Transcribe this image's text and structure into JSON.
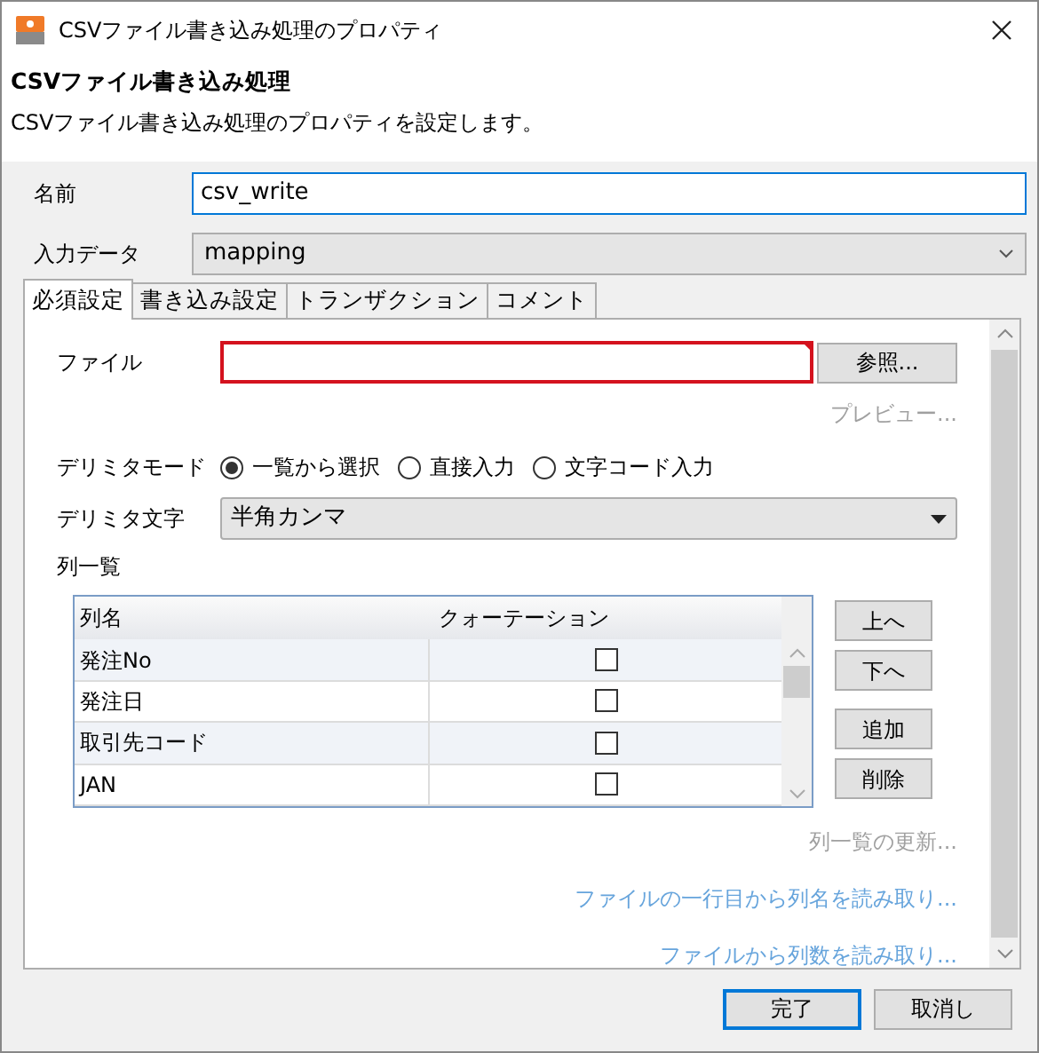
{
  "window": {
    "title": "CSVファイル書き込み処理のプロパティ"
  },
  "header": {
    "title": "CSVファイル書き込み処理",
    "description": "CSVファイル書き込み処理のプロパティを設定します。"
  },
  "name_field": {
    "label": "名前",
    "value": "csv_write"
  },
  "input_data": {
    "label": "入力データ",
    "value": "mapping"
  },
  "tabs": [
    {
      "label": "必須設定",
      "selected": true
    },
    {
      "label": "書き込み設定",
      "selected": false
    },
    {
      "label": "トランザクション",
      "selected": false
    },
    {
      "label": "コメント",
      "selected": false
    }
  ],
  "file": {
    "label": "ファイル",
    "error": true,
    "browse_button": "参照...",
    "preview_link": {
      "label": "プレビュー...",
      "disabled": true
    }
  },
  "delimiter_mode": {
    "label": "デリミタモード",
    "options": [
      {
        "label": "一覧から選択",
        "selected": true
      },
      {
        "label": "直接入力",
        "selected": false
      },
      {
        "label": "文字コード入力",
        "selected": false
      }
    ]
  },
  "delimiter_char": {
    "label": "デリミタ文字",
    "value": "半角カンマ"
  },
  "column_list": {
    "label": "列一覧",
    "columns": [
      "列名",
      "クォーテーション"
    ],
    "rows": [
      {
        "name": "発注No",
        "checked": false
      },
      {
        "name": "発注日",
        "checked": false
      },
      {
        "name": "取引先コード",
        "checked": false
      },
      {
        "name": "JAN",
        "checked": false
      }
    ],
    "side_buttons": [
      "上へ",
      "下へ",
      "追加",
      "削除"
    ]
  },
  "links": [
    {
      "label": "列一覧の更新...",
      "disabled": true
    },
    {
      "label": "ファイルの一行目から列名を読み取り...",
      "disabled": false
    },
    {
      "label": "ファイルから列数を読み取り...",
      "disabled": false
    }
  ],
  "buttons": [
    {
      "label": "完了",
      "default": true
    },
    {
      "label": "取消し",
      "default": false
    }
  ]
}
